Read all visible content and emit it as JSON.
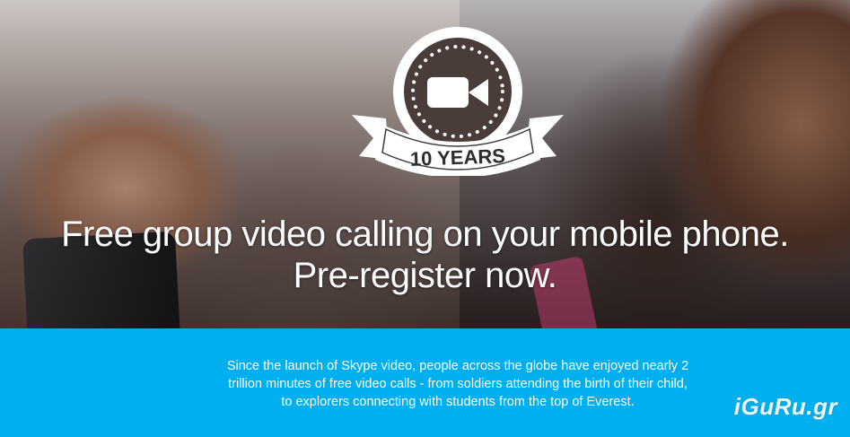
{
  "badge": {
    "text": "10 YEARS",
    "icon": "video-camera-icon"
  },
  "hero": {
    "headline_line1": "Free group video calling on your mobile phone.",
    "headline_line2": "Pre-register now."
  },
  "info": {
    "body": "Since the launch of Skype video, people across the globe have enjoyed nearly 2 trillion minutes of free video calls - from soldiers attending the birth of their child, to explorers connecting with students from the top of Everest."
  },
  "watermark": {
    "text": "iGuRu.gr"
  },
  "colors": {
    "band": "#00aff0",
    "text": "#ffffff"
  }
}
